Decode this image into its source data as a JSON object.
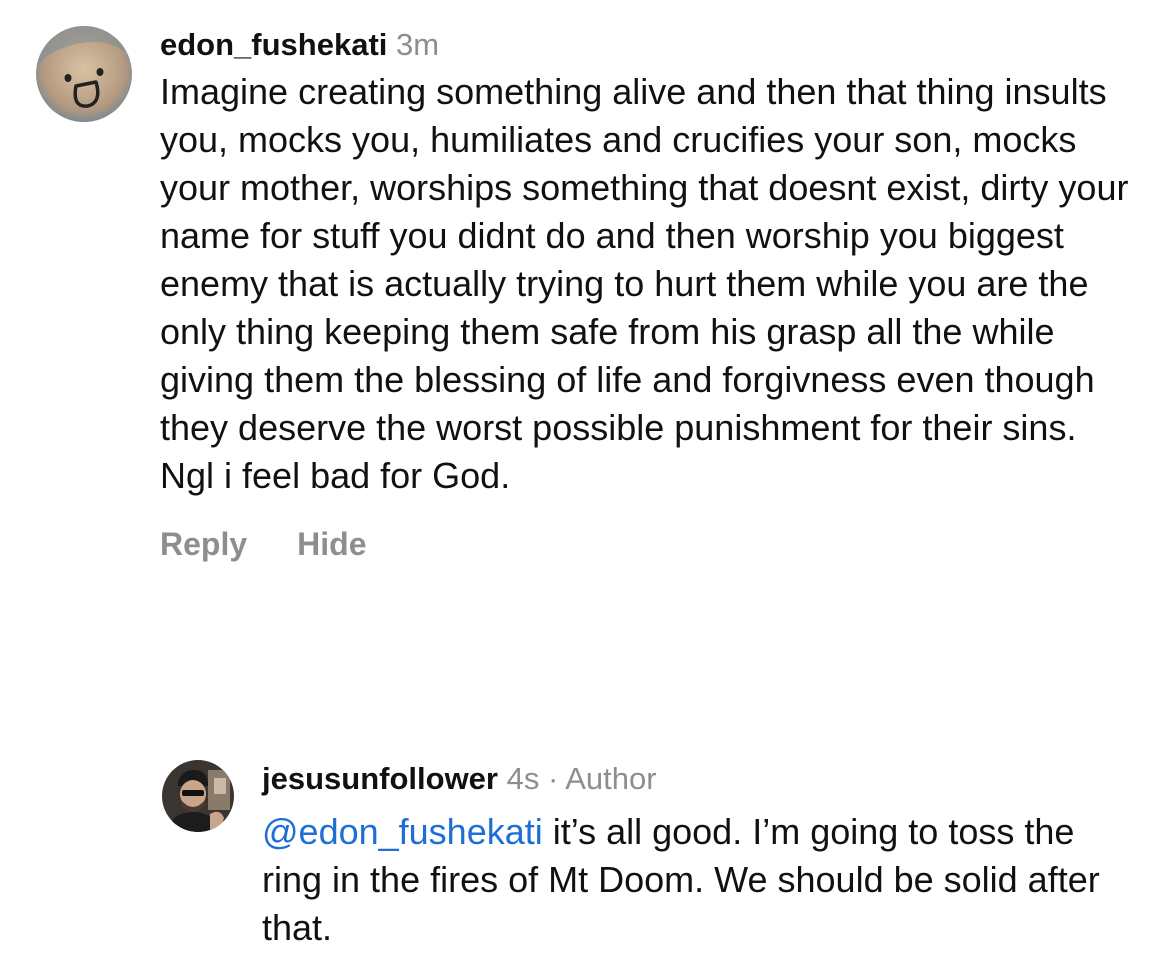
{
  "comments": [
    {
      "username": "edon_fushekati",
      "time": "3m",
      "text": "Imagine creating something alive and then that thing insults you, mocks you, humiliates and crucifies your son, mocks your mother, worships something that doesnt exist, dirty your name for stuff you didnt do and then worship you biggest enemy that is actually trying to hurt them while you are the only thing keeping them safe from his grasp all the while giving them the blessing of life and forgivness even though they deserve the worst possible punishment for their sins. Ngl i feel bad for God.",
      "reply_label": "Reply",
      "hide_label": "Hide",
      "avatar_icon": "hand-drawn-smiley-avatar"
    },
    {
      "username": "jesusunfollower",
      "time": "4s",
      "separator": "·",
      "badge": "Author",
      "mention": "@edon_fushekati",
      "text": " it’s all good. I’m going to toss the ring in the fires of Mt Doom. We should be solid after that.",
      "avatar_icon": "user-photo-avatar"
    }
  ],
  "colors": {
    "text": "#111111",
    "muted": "#8e8e8e",
    "mention": "#1d6fd6"
  }
}
